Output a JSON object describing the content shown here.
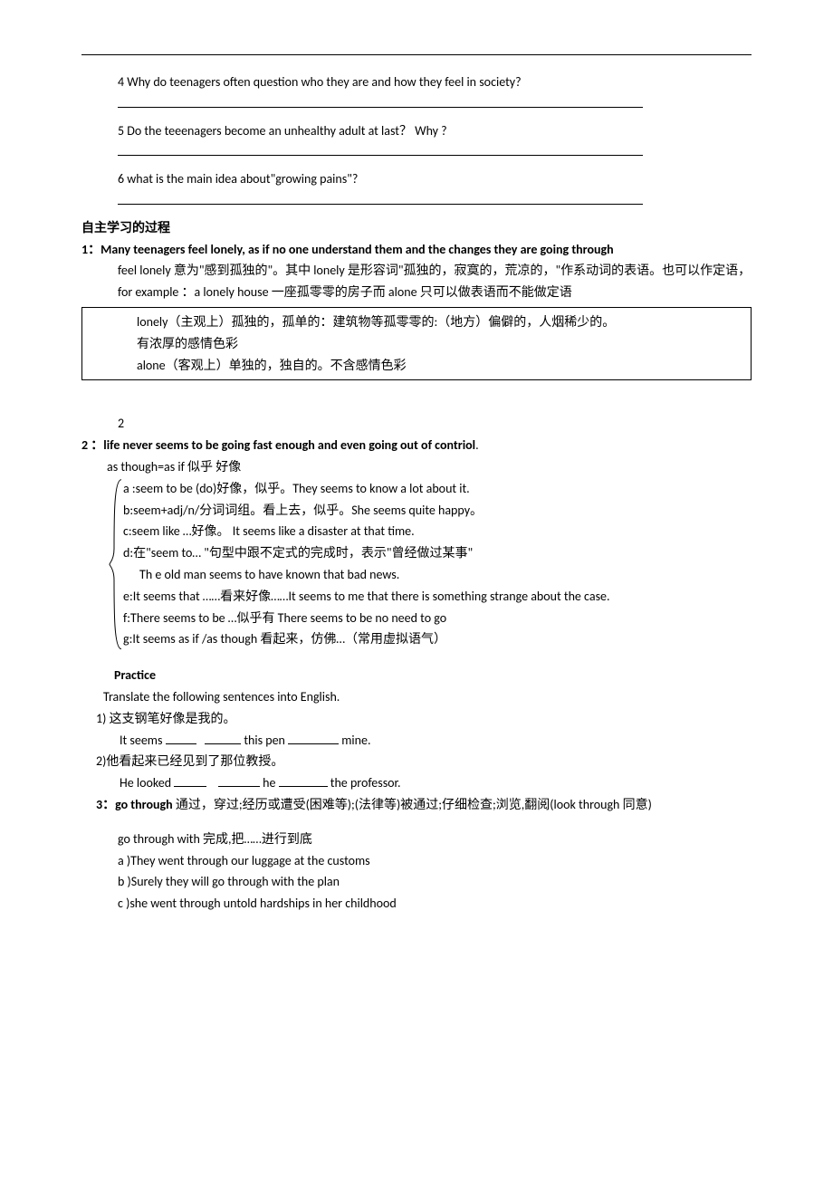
{
  "questions": {
    "q4": "4 Why do teenagers often question who they are and how they feel in society?",
    "q5": "5 Do the teeenagers become an unhealthy adult at last？  Why ?",
    "q6": "6 what is the main idea about\"growing pains\"?"
  },
  "section_heading": "自主学习的过程",
  "point1": {
    "title": "1：Many teenagers feel lonely, as if no one understand them and the changes they are going through",
    "para1": "feel lonely 意为\"感到孤独的\"。其中 lonely 是形容词\"孤独的，寂寞的，荒凉的，\"作系动词的表语。也可以作定语，for example ：a lonely house 一座孤零零的房子而 alone 只可以做表语而不能做定语",
    "box_line1": "lonely（主观上）孤独的，孤单的：建筑物等孤零零的:（地方）偏僻的，人烟稀少的。",
    "box_line2": "有浓厚的感情色彩",
    "box_line3": "alone（客观上）单独的，独自的。不含感情色彩",
    "end_marker": "2"
  },
  "point2": {
    "title": "2 ：life never seems to be going fast enough and even going out of contriol",
    "as_though": "as though=as if 似乎 好像",
    "a": "a :seem to be (do)好像，似乎。They seems to know a lot about it.",
    "b": "b:seem+adj/n/分词词组。看上去，似乎。She seems quite happy。",
    "c": "c:seem like …好像。                It seems like a disaster at that time.",
    "d": "d:在\"seem to… \"句型中跟不定式的完成时，表示\"曾经做过某事\"",
    "d_ex": "Th e old man seems to have known that bad news.",
    "e": "e:It seems that ……看来好像……It seems to me that there is something strange about the case.",
    "f": "f:There seems to be …似乎有 There seems to be no need to go",
    "g": "g:It seems as if /as though 看起来，仿佛…（常用虚拟语气）"
  },
  "practice": {
    "heading": "Practice",
    "instruction": "Translate the following sentences into English.",
    "p1_zh": "1) 这支钢笔好像是我的。",
    "p1_en_a": "It seems ",
    "p1_en_b": " this pen ",
    "p1_en_c": "      mine.",
    "p2_zh": "2)他看起来已经见到了那位教授。",
    "p2_en_a": "He looked ",
    "p2_en_b": " he ",
    "p2_en_c": "        the professor."
  },
  "point3": {
    "title": "3：go through 通过，穿过;经历或遭受(困难等);(法律等)被通过;仔细检查;浏览,翻阅(look through 同意)",
    "sub": "go through with 完成,把……进行到底",
    "a": "a )They went through our luggage at the customs",
    "b": "b )Surely they will go through with the plan",
    "c": "c )she went through untold hardships in her childhood"
  }
}
